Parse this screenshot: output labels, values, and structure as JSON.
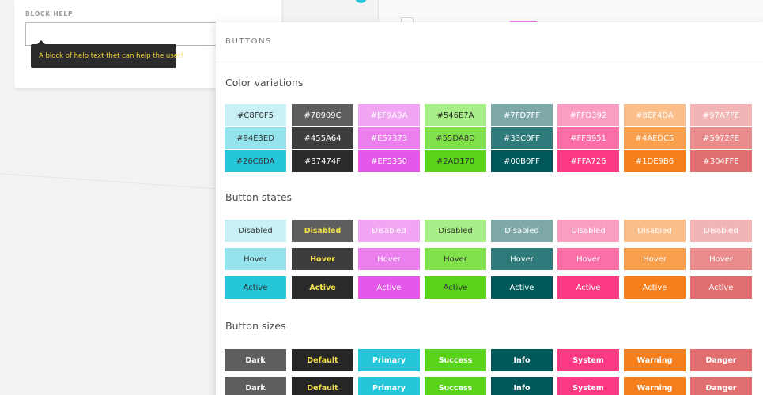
{
  "back_card": {
    "label": "BLOCK HELP",
    "tooltip": "A block of help text thet can help the user!"
  },
  "panel": {
    "title": "BUTTONS",
    "sections": {
      "colors": "Color variations",
      "states": "Button states",
      "sizes": "Button sizes"
    }
  },
  "palette": [
    {
      "shades": [
        "#C8F0F5",
        "#94E3ED",
        "#26C6DA"
      ],
      "states": [
        "#C8F0F5",
        "#94E3ED",
        "#26C6DA"
      ],
      "text": "dark"
    },
    {
      "shades": [
        "#78909C",
        "#455A64",
        "#37474F"
      ],
      "states": [
        "#78909C",
        "#455A64",
        "#37474F"
      ],
      "text": "yellow"
    },
    {
      "shades": [
        "#EF9A9A",
        "#E57373",
        "#EF5350"
      ],
      "states": [
        "#EF9A9A",
        "#E57373",
        "#EF5350"
      ],
      "text": "light"
    },
    {
      "shades": [
        "#546E7A",
        "#55DA8D",
        "#2AD170"
      ],
      "states": [
        "#546E7A",
        "#55DA8D",
        "#2AD170"
      ],
      "text": "dark"
    },
    {
      "shades": [
        "#7FD7FF",
        "#33C0FF",
        "#00B0FF"
      ],
      "states": [
        "#7FD7FF",
        "#33C0FF",
        "#00B0FF"
      ],
      "text": "light"
    },
    {
      "shades": [
        "#FFD392",
        "#FFB951",
        "#FFA726"
      ],
      "states": [
        "#FFD392",
        "#FFB951",
        "#FFA726"
      ],
      "text": "light"
    },
    {
      "shades": [
        "#8EF4DA",
        "#4AEDC5",
        "#1DE9B6"
      ],
      "states": [
        "#8EF4DA",
        "#4AEDC5",
        "#1DE9B6"
      ],
      "text": "light"
    },
    {
      "shades": [
        "#97A7FE",
        "#5972FE",
        "#304FFE"
      ],
      "states": [
        "#97A7FE",
        "#5972FE",
        "#304FFE"
      ],
      "text": "light"
    }
  ],
  "swatch_colors": [
    [
      "#c8f0f5",
      "#94e3ed",
      "#26c6da"
    ],
    [
      "#5e5e5e",
      "#3d3d3d",
      "#2a2a2a"
    ],
    [
      "#f0a6f3",
      "#eb7fee",
      "#e358e8"
    ],
    [
      "#a8ee88",
      "#7fe04a",
      "#5ad31b"
    ],
    [
      "#7fa8a8",
      "#2f7b7b",
      "#00585a"
    ],
    [
      "#fa9dc3",
      "#fb6fa6",
      "#fb3a83"
    ],
    [
      "#fbbf8b",
      "#f9a04f",
      "#f47f1c"
    ],
    [
      "#f1b5b5",
      "#ea8c8c",
      "#e26f6f"
    ]
  ],
  "state_labels": [
    "Disabled",
    "Hover",
    "Active"
  ],
  "size_labels": [
    "Dark",
    "Default",
    "Primary",
    "Success",
    "Info",
    "System",
    "Warning",
    "Danger"
  ]
}
